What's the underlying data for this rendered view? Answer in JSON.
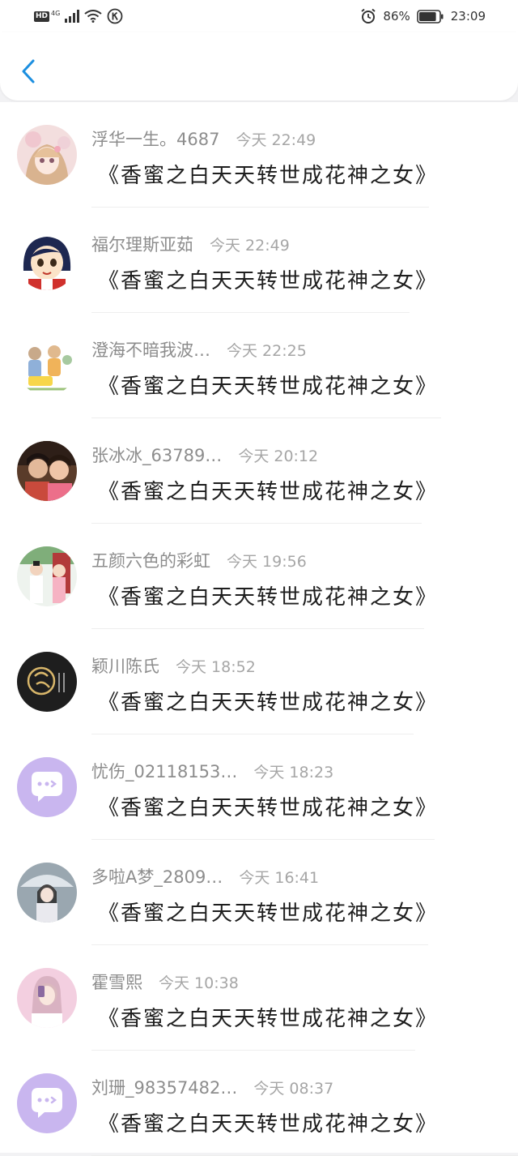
{
  "status_bar": {
    "hd": "HD",
    "network": "4G",
    "battery_percent": "86%",
    "battery_level": 0.86,
    "time": "23:09"
  },
  "header": {
    "back_icon": "chevron-left-icon",
    "accent_color": "#1c8fe0"
  },
  "comments": [
    {
      "name": "浮华一生。4687",
      "time": "今天 22:49",
      "text": "《香蜜之白天天转世成花神之女》",
      "avatar": "anime-girl"
    },
    {
      "name": "福尔理斯亚茹",
      "time": "今天 22:49",
      "text": "《香蜜之白天天转世成花神之女》",
      "avatar": "cartoon-girl"
    },
    {
      "name": "澄海不暗我波…",
      "time": "今天 22:25",
      "text": "《香蜜之白天天转世成花神之女》",
      "avatar": "illustration-people"
    },
    {
      "name": "张冰冰_63789…",
      "time": "今天 20:12",
      "text": "《香蜜之白天天转世成花神之女》",
      "avatar": "photo-two-people"
    },
    {
      "name": "五颜六色的彩虹",
      "time": "今天 19:56",
      "text": "《香蜜之白天天转世成花神之女》",
      "avatar": "costume-drama"
    },
    {
      "name": "颖川陈氏",
      "time": "今天 18:52",
      "text": "《香蜜之白天天转世成花神之女》",
      "avatar": "calligraphy-logo"
    },
    {
      "name": "忧伤_02118153…",
      "time": "今天 18:23",
      "text": "《香蜜之白天天转世成花神之女》",
      "avatar": "default-chat"
    },
    {
      "name": "多啦A梦_2809…",
      "time": "今天 16:41",
      "text": "《香蜜之白天天转世成花神之女》",
      "avatar": "photo-girl-umbrella"
    },
    {
      "name": "霍雪熙",
      "time": "今天 10:38",
      "text": "《香蜜之白天天转世成花神之女》",
      "avatar": "photo-girl-pink"
    },
    {
      "name": "刘珊_98357482…",
      "time": "今天 08:37",
      "text": "《香蜜之白天天转世成花神之女》",
      "avatar": "default-chat"
    }
  ]
}
